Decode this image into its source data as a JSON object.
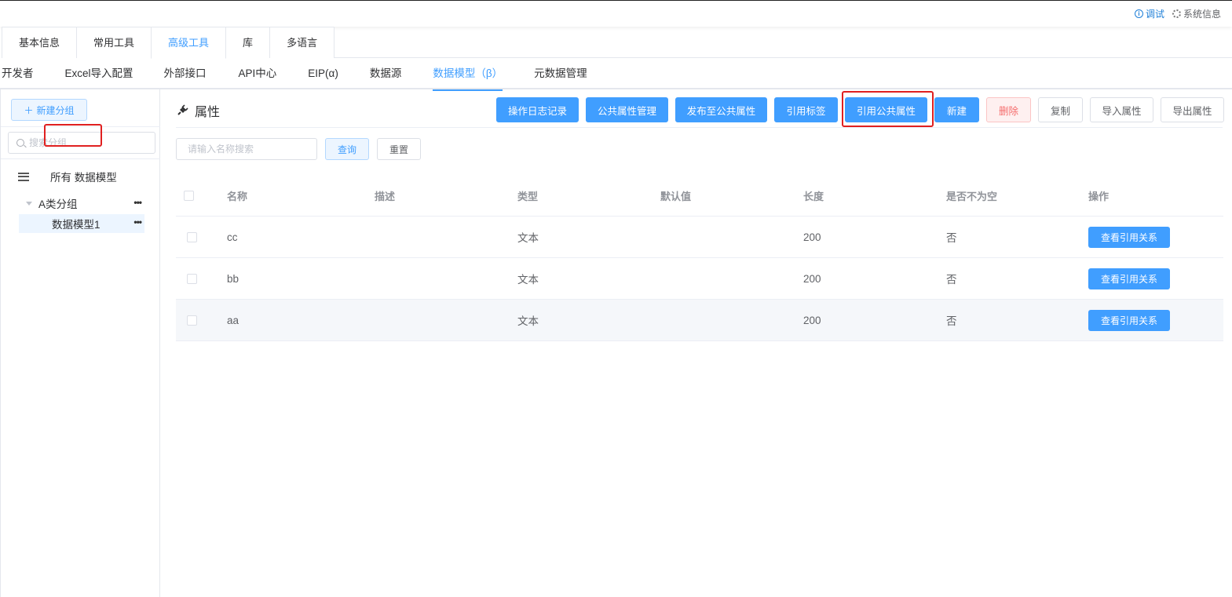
{
  "header": {
    "debug_label": "调试",
    "sysinfo_label": "系统信息"
  },
  "top_tabs": [
    "基本信息",
    "常用工具",
    "高级工具",
    "库",
    "多语言"
  ],
  "sub_tabs": [
    "开发者",
    "Excel导入配置",
    "外部接口",
    "API中心",
    "EIP(α)",
    "数据源",
    "数据模型（β）",
    "元数据管理"
  ],
  "sidebar": {
    "new_group_label": "新建分组",
    "search_placeholder": "搜索分组",
    "all_models_label": "所有 数据模型",
    "group_name": "A类分组",
    "model_name": "数据模型1"
  },
  "main": {
    "title": "属性",
    "toolbar": {
      "op_log": "操作日志记录",
      "public_attr_mgmt": "公共属性管理",
      "publish_public": "发布至公共属性",
      "ref_tag": "引用标签",
      "ref_public_attr": "引用公共属性",
      "new": "新建",
      "delete": "删除",
      "copy": "复制",
      "import_attr": "导入属性",
      "export_attr": "导出属性"
    },
    "search_placeholder": "请输入名称搜索",
    "query_label": "查询",
    "reset_label": "重置"
  },
  "table": {
    "headers": [
      "名称",
      "描述",
      "类型",
      "默认值",
      "长度",
      "是否不为空",
      "操作"
    ],
    "rows": [
      {
        "name": "cc",
        "desc": "",
        "type": "文本",
        "default": "",
        "length": "200",
        "not_null": "否",
        "action": "查看引用关系"
      },
      {
        "name": "bb",
        "desc": "",
        "type": "文本",
        "default": "",
        "length": "200",
        "not_null": "否",
        "action": "查看引用关系"
      },
      {
        "name": "aa",
        "desc": "",
        "type": "文本",
        "default": "",
        "length": "200",
        "not_null": "否",
        "action": "查看引用关系"
      }
    ]
  },
  "colors": {
    "primary": "#409eff",
    "danger": "#f56c6c",
    "highlight_box": "#e02020"
  }
}
